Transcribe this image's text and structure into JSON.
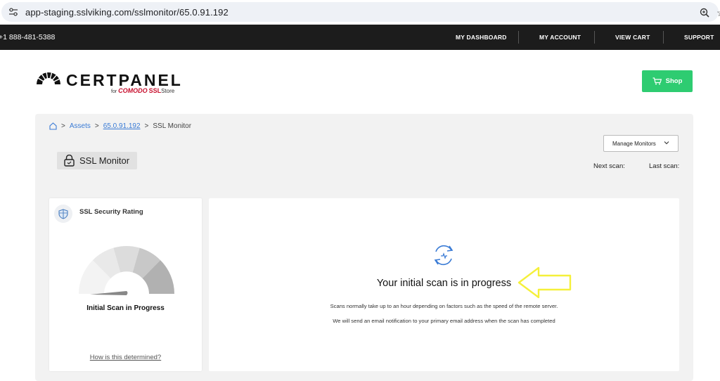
{
  "browser": {
    "url": "app-staging.sslviking.com/sslmonitor/65.0.91.192"
  },
  "topnav": {
    "phone": "+1 888-481-5388",
    "links": [
      "MY DASHBOARD",
      "MY ACCOUNT",
      "VIEW CART",
      "SUPPORT"
    ]
  },
  "logo": {
    "name": "CERTPANEL",
    "for": "for",
    "comodo": "COMODO",
    "ssl": "SSL",
    "store": "Store"
  },
  "header": {
    "shop_label": "Shop"
  },
  "breadcrumb": {
    "sep": ">",
    "items": [
      "Assets",
      "65.0.91.192",
      "SSL Monitor"
    ]
  },
  "page": {
    "title": "SSL Monitor",
    "manage_label": "Manage Monitors",
    "next_scan_label": "Next scan:",
    "last_scan_label": "Last scan:"
  },
  "rating": {
    "title": "SSL Security Rating",
    "status": "Initial Scan in Progress",
    "how_link": "How is this determined?",
    "gauge_level": 0
  },
  "progress": {
    "title": "Your initial scan is in progress",
    "note1": "Scans normally take up to an hour depending on factors such as the speed of the remote server.",
    "note2": "We will send an email notification to your primary email address when the scan has completed"
  },
  "colors": {
    "accent_green": "#2ecc71",
    "link_blue": "#3a7bd5",
    "annotation_yellow": "#f5f03a",
    "nav_black": "#1c1c1c"
  },
  "icons": [
    "tune-icon",
    "zoom-icon",
    "star-icon",
    "cart-icon",
    "home-icon",
    "lock-icon",
    "chevron-down-icon",
    "shield-icon",
    "sync-icon",
    "arrow-annotation"
  ]
}
